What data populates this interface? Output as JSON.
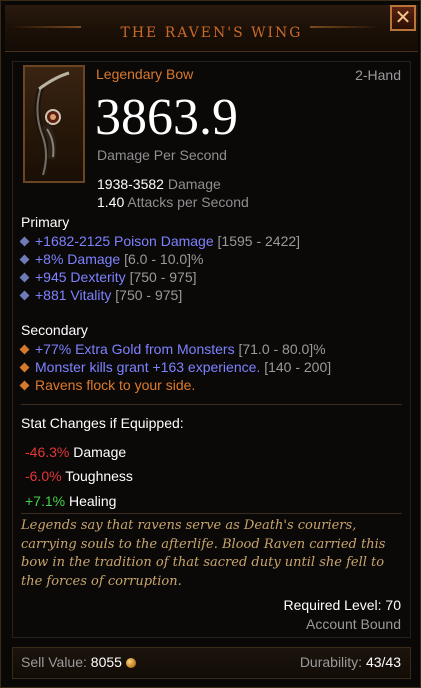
{
  "tooltip": {
    "title": "THE RAVEN'S WING",
    "close_glyph": "✕",
    "item_type": "Legendary Bow",
    "slot": "2-Hand",
    "dps_value": "3863.9",
    "dps_label": "Damage Per Second",
    "damage_range": "1938-3582",
    "damage_label": "Damage",
    "attack_speed": "1.40",
    "attack_speed_label": "Attacks per Second",
    "icon": "bow-icon"
  },
  "primary": {
    "heading": "Primary",
    "affixes": [
      {
        "text": "+1682-2125 Poison Damage",
        "range": "[1595 - 2422]"
      },
      {
        "text": "+8% Damage",
        "range": "[6.0 - 10.0]%"
      },
      {
        "text": "+945 Dexterity",
        "range": "[750 - 975]"
      },
      {
        "text": "+881 Vitality",
        "range": "[750 - 975]"
      }
    ]
  },
  "secondary": {
    "heading": "Secondary",
    "affixes": [
      {
        "text": "+77% Extra Gold from Monsters",
        "range": "[71.0 - 80.0]%"
      },
      {
        "text": "Monster kills grant +163 experience.",
        "range": "[140 - 200]"
      },
      {
        "text": "Ravens flock to your side.",
        "range": ""
      }
    ]
  },
  "stat_changes": {
    "heading": "Stat Changes if Equipped:",
    "items": [
      {
        "value": "-46.3%",
        "label": "Damage"
      },
      {
        "value": "-6.0%",
        "label": "Toughness"
      },
      {
        "value": "+7.1%",
        "label": "Healing"
      }
    ]
  },
  "flavor": {
    "text": "Legends say that ravens serve as Death's couriers, carrying souls to the afterlife. Blood Raven carried this bow in the tradition of that sacred duty until she fell to the forces of corruption."
  },
  "requirements": {
    "required_level": "Required Level: 70",
    "binding": "Account Bound"
  },
  "footer": {
    "sell_label": "Sell Value:",
    "sell_value": "8055",
    "durability_label": "Durability:",
    "durability_value": "43/43"
  },
  "colors": {
    "title": "#c96a2a",
    "legendary": "#d9782d",
    "magic_affix": "#7d82ff",
    "decrease": "#e23636",
    "increase": "#41d24a",
    "flavor": "#c9a56d"
  }
}
